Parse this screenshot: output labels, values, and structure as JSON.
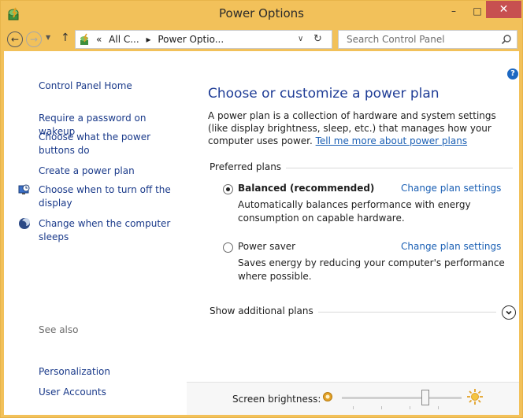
{
  "window": {
    "title": "Power Options",
    "minimize_glyph": "–",
    "maximize_glyph": "□",
    "close_glyph": "✕"
  },
  "nav": {
    "back_glyph": "←",
    "forward_glyph": "→",
    "dropdown_glyph": "▼",
    "up_glyph": "↑"
  },
  "address": {
    "crumbs": [
      "«",
      "All C...",
      "▸",
      "Power Optio..."
    ],
    "dropdown_glyph": "∨",
    "refresh_glyph": "↻"
  },
  "search": {
    "placeholder": "Search Control Panel"
  },
  "sidebar": {
    "items": [
      {
        "label": "Control Panel Home"
      },
      {
        "label": "Require a password on wakeup"
      },
      {
        "label": "Choose what the power buttons do"
      },
      {
        "label": "Create a power plan"
      },
      {
        "label": "Choose when to turn off the display",
        "icon": "display-clock-icon"
      },
      {
        "label": "Change when the computer sleeps",
        "icon": "moon-sleep-icon"
      }
    ],
    "see_also": {
      "label": "See also",
      "items": [
        {
          "label": "Personalization"
        },
        {
          "label": "User Accounts"
        }
      ]
    }
  },
  "main": {
    "help_glyph": "?",
    "heading": "Choose or customize a power plan",
    "description": "A power plan is a collection of hardware and system settings (like display brightness, sleep, etc.) that manages how your computer uses power.",
    "learn_more": "Tell me more about power plans",
    "preferred_label": "Preferred plans",
    "plans": [
      {
        "name": "Balanced (recommended)",
        "selected": true,
        "link": "Change plan settings",
        "description": "Automatically balances performance with energy consumption on capable hardware."
      },
      {
        "name": "Power saver",
        "selected": false,
        "link": "Change plan settings",
        "description": "Saves energy by reducing your computer's performance where possible."
      }
    ],
    "additional_label": "Show additional plans"
  },
  "brightness": {
    "label": "Screen brightness:",
    "level": 0.7
  },
  "colors": {
    "titlebar": "#f2c15a",
    "link": "#1a3a8a",
    "heading": "#1e3c96",
    "close": "#c75050"
  }
}
